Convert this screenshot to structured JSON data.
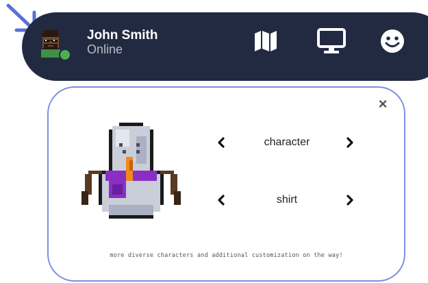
{
  "user": {
    "name": "John Smith",
    "status": "Online",
    "status_color": "#4caf50"
  },
  "nav": {
    "icons": [
      "map-icon",
      "monitor-icon",
      "smiley-icon"
    ]
  },
  "panel": {
    "close_label": "×",
    "selectors": [
      {
        "label": "character"
      },
      {
        "label": "shirt"
      }
    ],
    "footnote": "more diverse characters and additional customization on the way!"
  },
  "colors": {
    "topbar_bg": "#222a42",
    "panel_border": "#7b8ee3",
    "pointer_arrow": "#5a6fd8"
  }
}
